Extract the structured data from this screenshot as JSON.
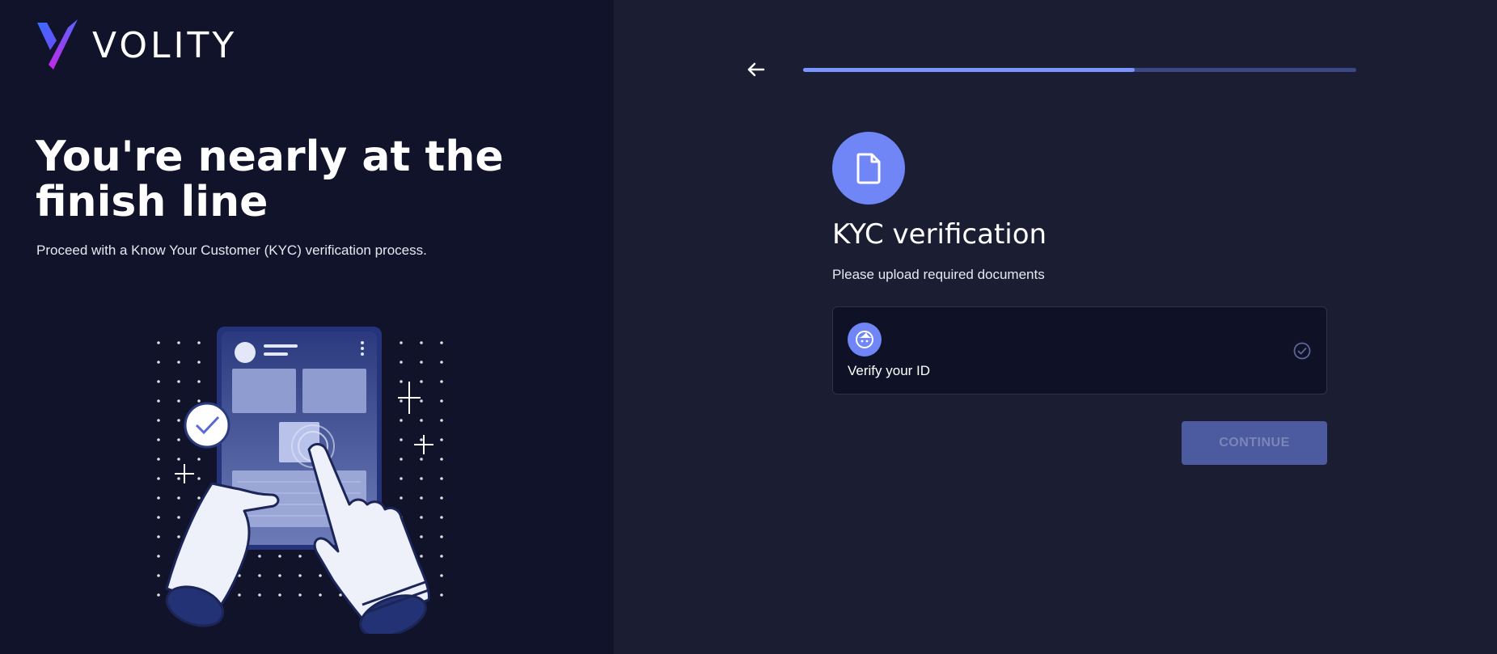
{
  "brand": {
    "name": "VOLITY"
  },
  "left": {
    "headline": "You're nearly at the finish line",
    "subtext": "Proceed with a Know Your Customer (KYC) verification process."
  },
  "progress": {
    "fraction": 0.6
  },
  "main": {
    "title": "KYC verification",
    "description": "Please upload required documents",
    "document_item": {
      "label": "Verify your ID",
      "icon": "face-icon",
      "status_icon": "check-circle-icon"
    },
    "continue_label": "CONTINUE",
    "continue_disabled": true
  },
  "colors": {
    "accent": "#7086f6",
    "progress_fill": "#7a95ff",
    "progress_track": "#3c4785",
    "left_bg": "#10132a",
    "right_bg": "#1b1e33",
    "button_disabled_bg": "#4c5a9f"
  }
}
